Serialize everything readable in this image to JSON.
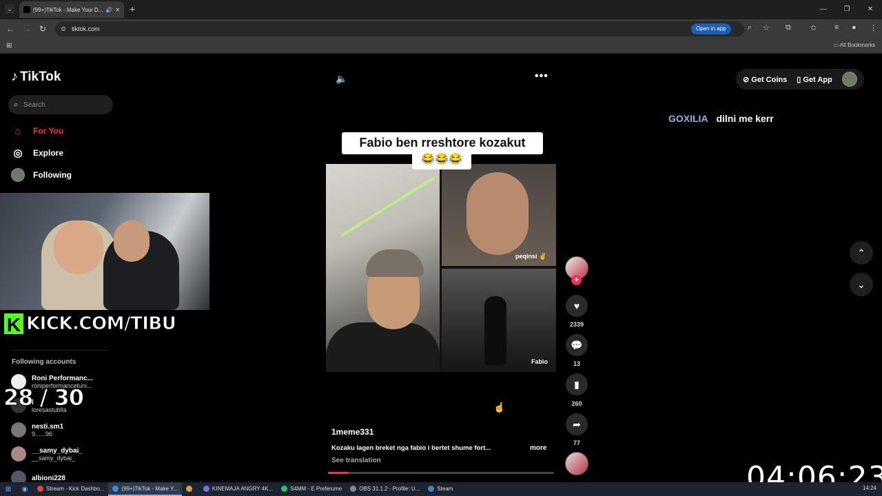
{
  "browser": {
    "tab_title": "(99+)TikTok - Make Your D...",
    "url": "tiktok.com",
    "open_in_app": "Open in app",
    "all_bookmarks": "All Bookmarks"
  },
  "tiktok": {
    "logo": "TikTok",
    "search_placeholder": "Search",
    "nav": [
      {
        "label": "For You"
      },
      {
        "label": "Explore"
      },
      {
        "label": "Following"
      }
    ],
    "following_header": "Following accounts",
    "following": [
      {
        "name": "Roni Performanc...",
        "handle": "roniperformancetuni..."
      },
      {
        "name": "l",
        "handle": "loresastublla"
      },
      {
        "name": "nesti.sm1",
        "handle": "9......96"
      },
      {
        "name": "__samy_dybai_",
        "handle": "__samy_dybai_"
      },
      {
        "name": "albioni228",
        "handle": ""
      }
    ],
    "get_coins": "Get Coins",
    "get_app": "Get App"
  },
  "overlay": {
    "kick": "KICK.COM/TIBU",
    "counter": "28 / 30",
    "timer": "04:06:23"
  },
  "video": {
    "caption": "Fabio ben rreshtore kozakut",
    "caption_emoji": "😂😂😂",
    "label_top_right": "peqinsi ✌",
    "label_bottom_right": "Fabio",
    "author": "1meme331",
    "description": "Kozaku lagen breket nga fabio i bertet shume fort...",
    "more": "more",
    "see_translation": "See translation",
    "progress": 0.09
  },
  "actions": {
    "likes": "2339",
    "comments": "13",
    "saves": "260",
    "shares": "77"
  },
  "comment": {
    "user": "GOXILIA",
    "text": "dilni me kerr"
  },
  "taskbar": {
    "items": [
      {
        "label": "Stream - Kick Dashbo...",
        "color": "#e04a3a"
      },
      {
        "label": "(99+)TikTok - Make Y...",
        "color": "#3a8fe0"
      },
      {
        "label": "",
        "color": "#e0a030"
      },
      {
        "label": "KINEMAJA ANGRY 4K...",
        "color": "#7f6fe0"
      },
      {
        "label": "S4MM - E Preferume",
        "color": "#2dc55a"
      },
      {
        "label": "OBS 31.1.2 - Profile: U...",
        "color": "#888888"
      },
      {
        "label": "Steam",
        "color": "#4a7fbf"
      }
    ],
    "clock": "14:24"
  }
}
